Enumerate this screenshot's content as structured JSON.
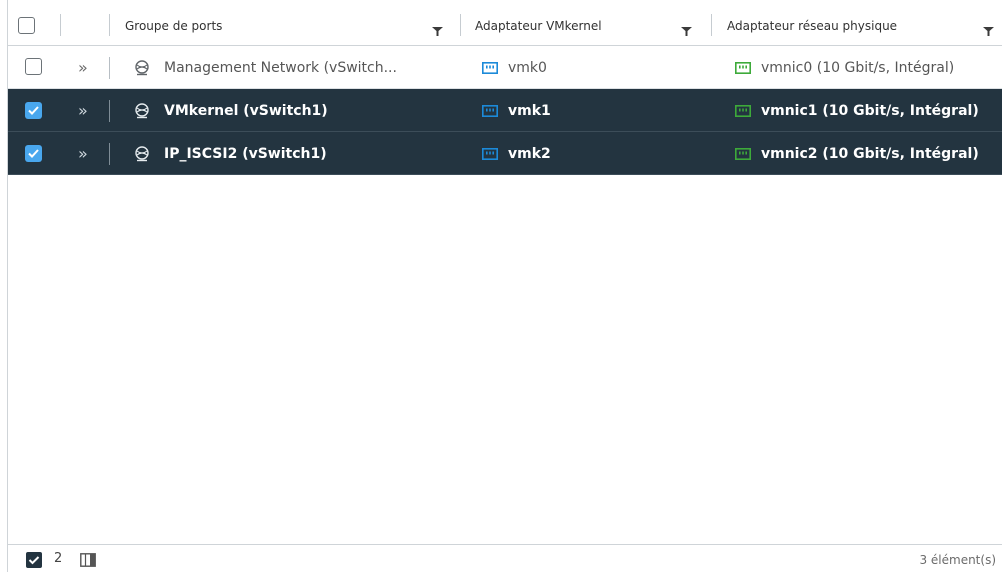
{
  "columns": {
    "port_group": "Groupe de ports",
    "vmkernel_adapter": "Adaptateur VMkernel",
    "physical_adapter": "Adaptateur réseau physique"
  },
  "rows": [
    {
      "selected": false,
      "port_group": "Management Network (vSwitch...",
      "vmkernel": "vmk0",
      "physical": "vmnic0 (10 Gbit/s, Intégral)"
    },
    {
      "selected": true,
      "port_group": "VMkernel (vSwitch1)",
      "vmkernel": "vmk1",
      "physical": "vmnic1 (10 Gbit/s, Intégral)"
    },
    {
      "selected": true,
      "port_group": "IP_ISCSI2 (vSwitch1)",
      "vmkernel": "vmk2",
      "physical": "vmnic2 (10 Gbit/s, Intégral)"
    }
  ],
  "expand_glyph": "»",
  "footer": {
    "selected_count": "2",
    "total": "3 élément(s)"
  },
  "colors": {
    "selected_row_bg": "#233440",
    "checkbox_checked": "#49a7ee",
    "vmk_icon": "#1c8ad9",
    "vmnic_icon": "#3daa3a"
  },
  "icons": {
    "port_group": "network-globe-icon",
    "vmkernel": "vmkernel-adapter-icon",
    "physical": "physical-nic-icon",
    "filter": "filter-icon",
    "column_toggle": "column-toggle-icon"
  }
}
